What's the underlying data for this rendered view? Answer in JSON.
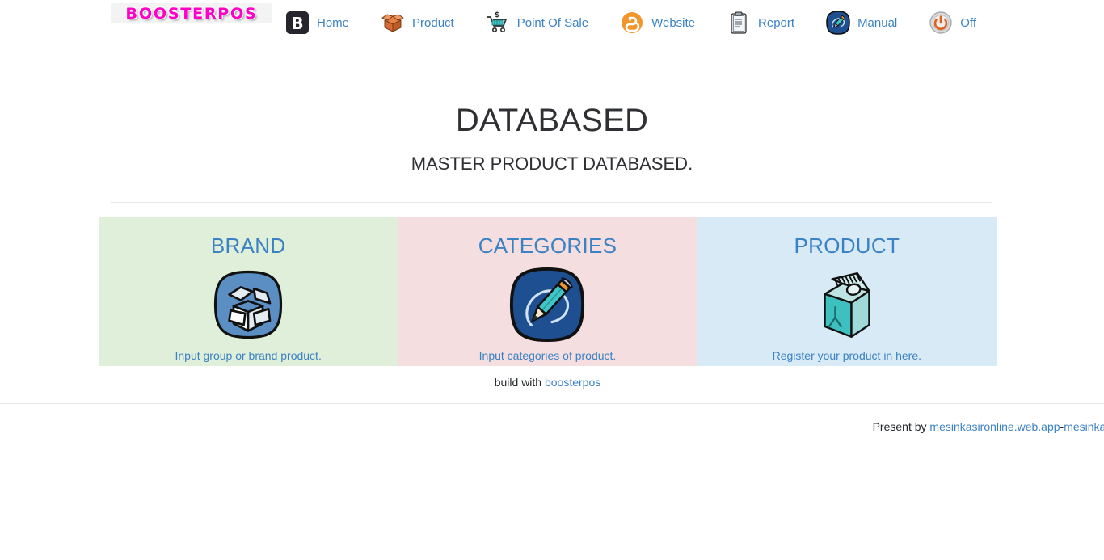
{
  "brand": {
    "logo_text": "BOOSTERPOS"
  },
  "nav": {
    "items": [
      {
        "label": "Home",
        "icon": "b-square-icon"
      },
      {
        "label": "Product",
        "icon": "open-box-icon"
      },
      {
        "label": "Point Of Sale",
        "icon": "shopping-cart-icon"
      },
      {
        "label": "Website",
        "icon": "blogger-icon"
      },
      {
        "label": "Report",
        "icon": "clipboard-icon"
      },
      {
        "label": "Manual",
        "icon": "pencil-circle-icon"
      },
      {
        "label": "Off",
        "icon": "power-icon"
      }
    ]
  },
  "main": {
    "title": "DATABASED",
    "subtitle": "MASTER PRODUCT DATABASED.",
    "cards": [
      {
        "title": "BRAND",
        "desc": "Input group or brand product.",
        "icon": "open-box-blue-circle-icon",
        "bg": "#e0efd9"
      },
      {
        "title": "CATEGORIES",
        "desc": "Input categories of product.",
        "icon": "pencil-circle-icon",
        "bg": "#f4dedf"
      },
      {
        "title": "PRODUCT",
        "desc": "Register your product in here.",
        "icon": "milk-carton-icon",
        "bg": "#d8eaf5"
      }
    ],
    "build_prefix": "build with",
    "build_link": "boosterpos"
  },
  "footer": {
    "prefix": "Present by",
    "link1": "mesinkasironline.web.app",
    "separator": "-",
    "link2": "mesinkasir.g"
  },
  "colors": {
    "accent_link": "#3b82c4",
    "logo": "#ff00c8",
    "text": "#212529"
  }
}
